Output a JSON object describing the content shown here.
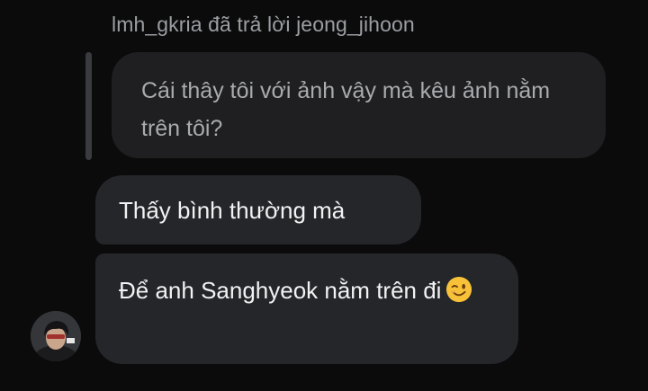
{
  "reply": {
    "header": "lmh_gkria đã trả lời jeong_jihoon",
    "quoted_message": "Cái thây tôi với ảnh vậy mà kêu ảnh nằm trên tôi?"
  },
  "messages": [
    {
      "text": "Thấy bình thường mà"
    },
    {
      "text": "Để anh Sanghyeok nằm trên đi",
      "emoji": "winking-face-emoji"
    }
  ],
  "colors": {
    "background": "#0b0b0c",
    "bubble": "#252629",
    "quoted_bubble": "#1f1f21",
    "reply_bar": "#3a3b3e",
    "emoji": "#f7c23a"
  }
}
